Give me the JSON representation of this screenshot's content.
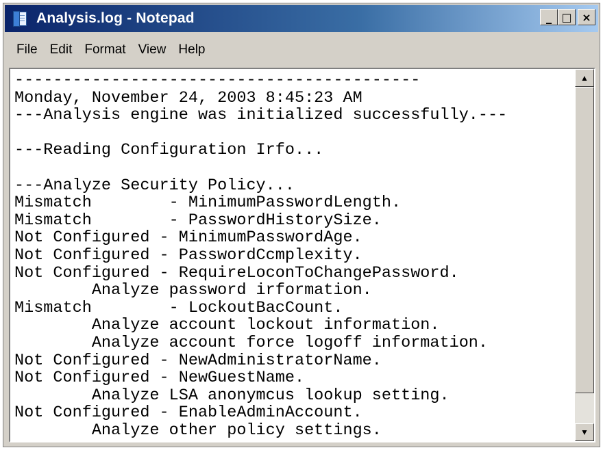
{
  "window": {
    "title": "Analysis.log - Notepad",
    "icon": "notepad-icon",
    "controls": {
      "minimize": "_",
      "maximize": "□",
      "close": "×"
    }
  },
  "menu": {
    "items": [
      "File",
      "Edit",
      "Format",
      "View",
      "Help"
    ]
  },
  "editor": {
    "lines": [
      "------------------------------------------",
      "Monday, November 24, 2003 8:45:23 AM",
      "---Analysis engine was initialized successfully.---",
      "",
      "---Reading Configuration Irfo...",
      "",
      "---Analyze Security Policy...",
      "Mismatch        - MinimumPasswordLength.",
      "Mismatch        - PasswordHistorySize.",
      "Not Configured - MinimumPasswordAge.",
      "Not Configured - PasswordCcmplexity.",
      "Not Configured - RequireLoconToChangePassword.",
      "        Analyze password irformation.",
      "Mismatch        - LockoutBacCount.",
      "        Analyze account lockout information.",
      "        Analyze account force logoff information.",
      "Not Configured - NewAdministratorName.",
      "Not Configured - NewGuestName.",
      "        Analyze LSA anonymcus lookup setting.",
      "Not Configured - EnableAdminAccount.",
      "        Analyze other policy settings."
    ]
  },
  "scrollbar": {
    "up_icon": "scroll-up-arrow-icon",
    "down_icon": "scroll-down-arrow-icon"
  }
}
